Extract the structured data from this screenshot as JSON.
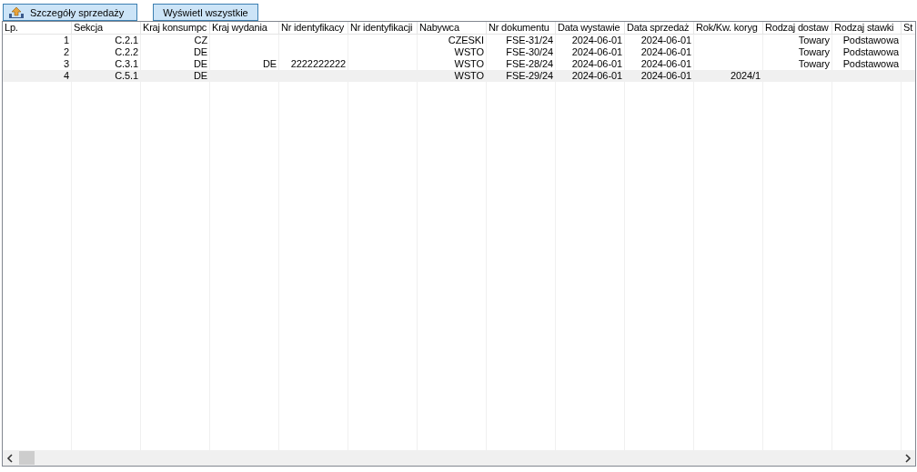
{
  "toolbar": {
    "buttons": [
      {
        "label": "Szczegóły sprzedaży",
        "icon": true
      },
      {
        "label": "Wyświetl wszystkie",
        "icon": false
      }
    ]
  },
  "table": {
    "columns": [
      "Lp.",
      "Sekcja",
      "Kraj konsumpc",
      "Kraj wydania",
      "Nr identyfikacy",
      "Nr identyfikacji",
      "Nabywca",
      "Nr dokumentu",
      "Data wystawie",
      "Data sprzedaż",
      "Rok/Kw. koryg",
      "Rodzaj dostaw",
      "Rodzaj stawki",
      "St"
    ],
    "rows": [
      {
        "selected": false,
        "cells": [
          "1",
          "C.2.1",
          "CZ",
          "",
          "",
          "",
          "CZESKI",
          "FSE-31/24",
          "2024-06-01",
          "2024-06-01",
          "",
          "Towary",
          "Podstawowa",
          ""
        ]
      },
      {
        "selected": false,
        "cells": [
          "2",
          "C.2.2",
          "DE",
          "",
          "",
          "",
          "WSTO",
          "FSE-30/24",
          "2024-06-01",
          "2024-06-01",
          "",
          "Towary",
          "Podstawowa",
          ""
        ]
      },
      {
        "selected": false,
        "cells": [
          "3",
          "C.3.1",
          "DE",
          "DE",
          "2222222222",
          "",
          "WSTO",
          "FSE-28/24",
          "2024-06-01",
          "2024-06-01",
          "",
          "Towary",
          "Podstawowa",
          ""
        ]
      },
      {
        "selected": true,
        "cells": [
          "4",
          "C.5.1",
          "DE",
          "",
          "",
          "",
          "WSTO",
          "FSE-29/24",
          "2024-06-01",
          "2024-06-01",
          "2024/1",
          "",
          "",
          ""
        ]
      }
    ]
  }
}
